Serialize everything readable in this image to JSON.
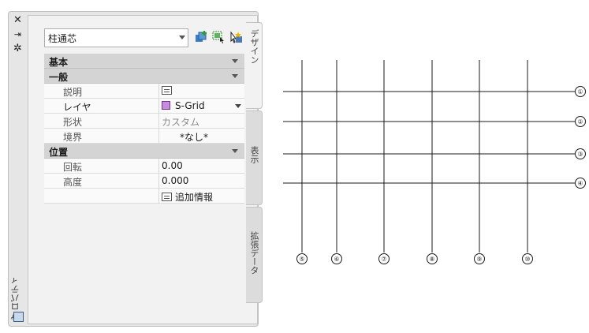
{
  "palette": {
    "title": "プロパティ",
    "selector_value": "柱通芯",
    "tabs": [
      {
        "label": "デザイン",
        "active": true
      },
      {
        "label": "表示",
        "active": false
      },
      {
        "label": "拡張データ",
        "active": false
      }
    ],
    "titlebar_icons": [
      "close-icon",
      "autohide-icon",
      "settings-icon"
    ],
    "toolbar_icons": [
      "add-icon",
      "select-objects-icon",
      "quick-select-icon"
    ]
  },
  "properties": {
    "cat_basic": "基本",
    "cat_general": "一般",
    "rows_general": [
      {
        "name": "説明",
        "value": "",
        "icon": "description-icon"
      },
      {
        "name": "レイヤ",
        "value": "S-Grid",
        "swatch": "#c98be0"
      },
      {
        "name": "形状",
        "value": "カスタム"
      },
      {
        "name": "境界",
        "value": "*なし*"
      }
    ],
    "cat_position": "位置",
    "rows_position": [
      {
        "name": "回転",
        "value": "0.00"
      },
      {
        "name": "高度",
        "value": "0.000"
      },
      {
        "name": "",
        "value": "追加情報"
      }
    ]
  },
  "grid": {
    "vertical_labels": [
      "⑤",
      "⑥",
      "⑦",
      "⑧",
      "⑨",
      "⑩"
    ],
    "horizontal_labels": [
      "①",
      "②",
      "③",
      "④"
    ]
  }
}
